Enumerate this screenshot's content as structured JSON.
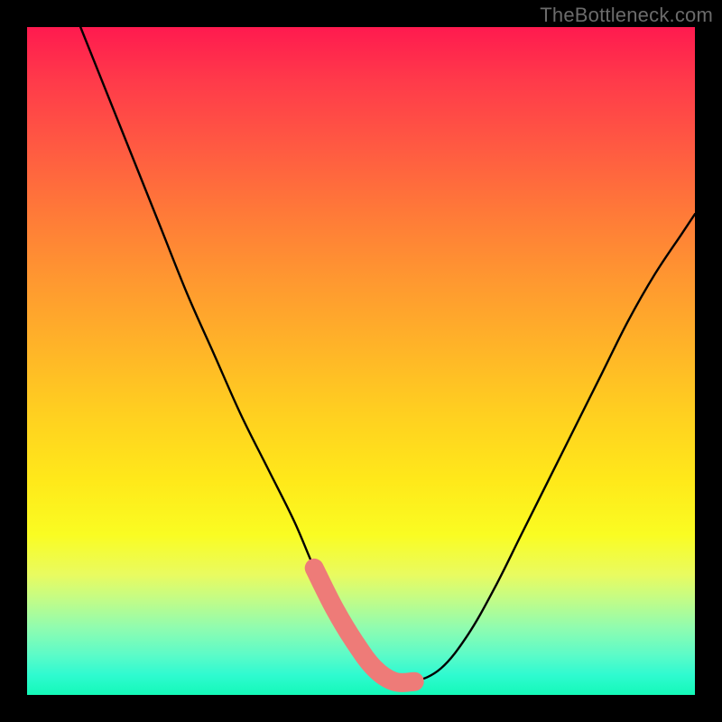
{
  "watermark": "TheBottleneck.com",
  "chart_data": {
    "type": "line",
    "title": "",
    "xlabel": "",
    "ylabel": "",
    "xlim": [
      0,
      100
    ],
    "ylim": [
      0,
      100
    ],
    "grid": false,
    "legend": false,
    "series": [
      {
        "name": "main-curve",
        "x": [
          8,
          12,
          16,
          20,
          24,
          28,
          32,
          36,
          40,
          43,
          46,
          49,
          52,
          55,
          58,
          62,
          66,
          70,
          74,
          78,
          82,
          86,
          90,
          94,
          98,
          100
        ],
        "y": [
          100,
          90,
          80,
          70,
          60,
          51,
          42,
          34,
          26,
          19,
          13,
          8,
          4,
          2,
          2,
          4,
          9,
          16,
          24,
          32,
          40,
          48,
          56,
          63,
          69,
          72
        ]
      }
    ],
    "highlight_segment": {
      "name": "optimal-zone",
      "x": [
        43,
        46,
        49,
        52,
        55,
        58
      ],
      "y": [
        19,
        13,
        8,
        4,
        2,
        2
      ],
      "color": "#ee7b78"
    },
    "background_gradient": {
      "top": "#ff1a4f",
      "middle": "#ffe91a",
      "bottom": "#14f9b8"
    }
  }
}
